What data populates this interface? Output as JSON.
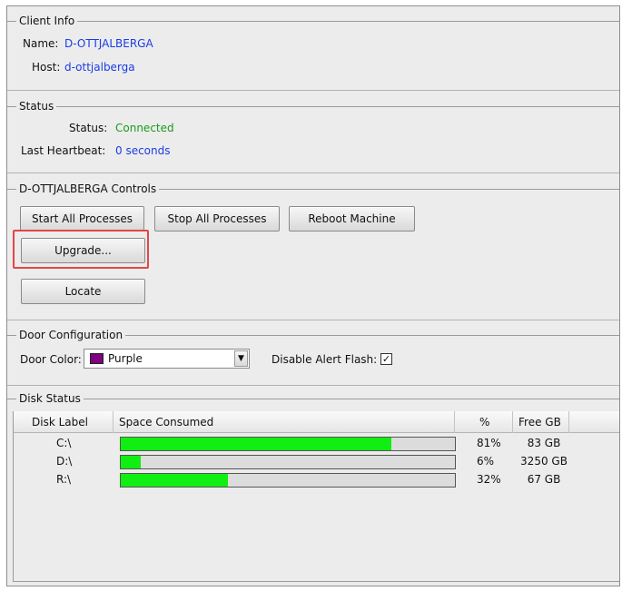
{
  "client_info": {
    "title": "Client Info",
    "name_label": "Name:",
    "name_value": "D-OTTJALBERGA",
    "host_label": "Host:",
    "host_value": "d-ottjalberga"
  },
  "status": {
    "title": "Status",
    "status_label": "Status:",
    "status_value": "Connected",
    "heartbeat_label": "Last Heartbeat:",
    "heartbeat_value": "0 seconds"
  },
  "controls": {
    "title": "D-OTTJALBERGA Controls",
    "start_all": "Start All Processes",
    "stop_all": "Stop All Processes",
    "reboot": "Reboot Machine",
    "upgrade": "Upgrade...",
    "locate": "Locate"
  },
  "door_config": {
    "title": "Door Configuration",
    "color_label": "Door Color:",
    "color_value": "Purple",
    "color_swatch": "#800080",
    "alert_label": "Disable Alert Flash:",
    "alert_checked": true,
    "check_glyph": "✓"
  },
  "disk_status": {
    "title": "Disk Status",
    "columns": [
      "Disk Label",
      "Space Consumed",
      "%",
      "Free GB"
    ],
    "rows": [
      {
        "label": "C:\\",
        "percent": "81%",
        "fraction": 0.81,
        "free": "83 GB"
      },
      {
        "label": "D:\\",
        "percent": "6%",
        "fraction": 0.06,
        "free": "3250 GB"
      },
      {
        "label": "R:\\",
        "percent": "32%",
        "fraction": 0.32,
        "free": "67 GB"
      }
    ],
    "bar_color": "#11ee11"
  },
  "highlight_color": "#e54646"
}
